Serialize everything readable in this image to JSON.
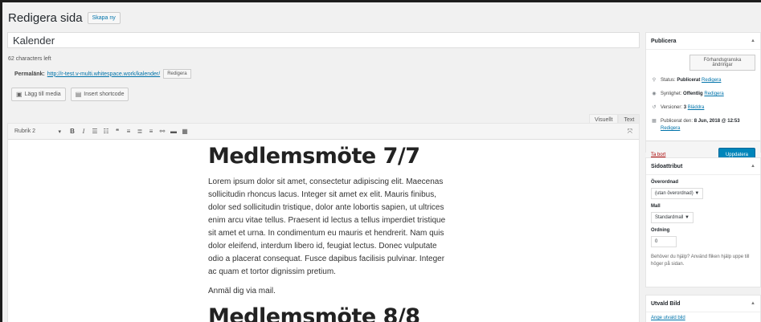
{
  "header": {
    "title": "Redigera sida",
    "new_button": "Skapa ny"
  },
  "post": {
    "title": "Kalender",
    "chars_left": "62 characters left",
    "permalink_label": "Permalänk:",
    "permalink_url": "http://r-test.v-multi.whitespace.work/kalender/",
    "permalink_edit": "Redigera"
  },
  "media": {
    "add_media": "Lägg till media",
    "insert_shortcode": "Insert shortcode"
  },
  "editor": {
    "tab_visual": "Visuellt",
    "tab_text": "Text",
    "format_select": "Rubrik 2",
    "content": {
      "heading1": "Medlemsmöte 7/7",
      "paragraph": "Lorem ipsum dolor sit amet, consectetur adipiscing elit. Maecenas sollicitudin rhoncus lacus. Integer sit amet ex elit. Mauris finibus, dolor sed sollicitudin tristique, dolor ante lobortis sapien, ut ultrices enim arcu vitae tellus. Praesent id lectus a tellus imperdiet tristique sit amet et urna. In condimentum eu mauris et hendrerit. Nam quis dolor eleifend, interdum libero id, feugiat lectus. Donec vulputate odio a placerat consequat. Fusce dapibus facilisis pulvinar. Integer ac quam et tortor dignissim pretium.",
      "signup": "Anmäl dig via mail.",
      "heading2": "Medlemsmöte 8/8"
    }
  },
  "publish": {
    "title": "Publicera",
    "preview_button": "Förhandsgranska ändringar",
    "status_label": "Status:",
    "status_value": "Publicerat",
    "status_edit": "Redigera",
    "visibility_label": "Synlighet:",
    "visibility_value": "Offentlig",
    "visibility_edit": "Redigera",
    "revisions_label": "Versioner:",
    "revisions_value": "3",
    "revisions_browse": "Bläddra",
    "published_label": "Publicerat den:",
    "published_value": "8 Jun, 2018 @ 12:53",
    "published_edit": "Redigera",
    "trash": "Ta bort",
    "update": "Uppdatera"
  },
  "page_attributes": {
    "title": "Sidoattribut",
    "parent_label": "Överordnad",
    "parent_value": "(utan överordnad)",
    "template_label": "Mall",
    "template_value": "Standardmall",
    "order_label": "Ordning",
    "order_value": "0",
    "help": "Behöver du hjälp? Använd fliken hjälp uppe till höger på sidan."
  },
  "featured_image": {
    "title": "Utvald Bild",
    "set_link": "Ange utvald bild"
  }
}
